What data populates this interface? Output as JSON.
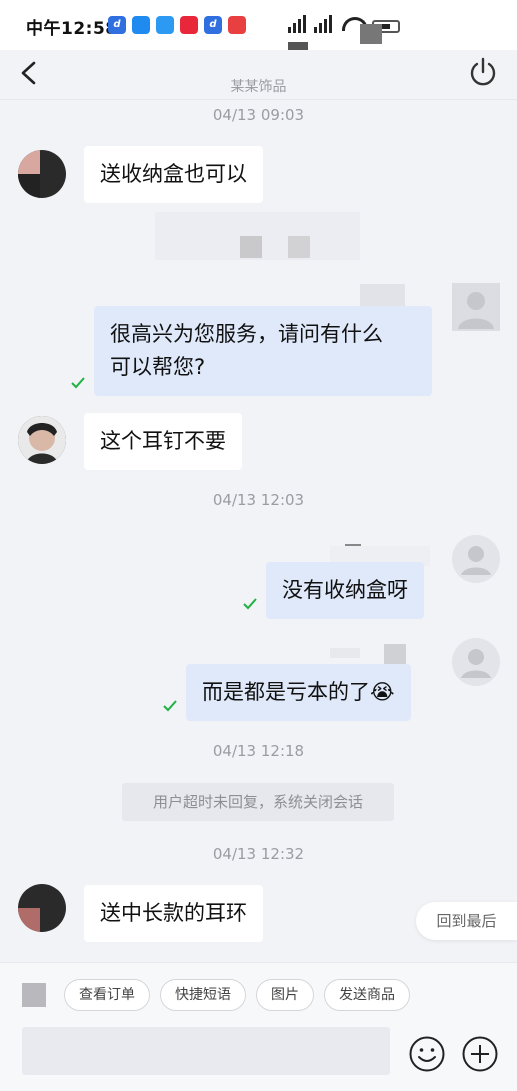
{
  "status_bar": {
    "time": "中午12:58",
    "apps": [
      {
        "icon": "d-app-icon",
        "text": "d",
        "color": "#2f6fe0"
      },
      {
        "icon": "blue-app-icon",
        "text": "",
        "color": "#1f8bf0"
      },
      {
        "icon": "blue-app-icon-2",
        "text": "",
        "color": "#2c9af2"
      },
      {
        "icon": "red-app-icon",
        "text": "",
        "color": "#e8273a"
      },
      {
        "icon": "d-app-icon-2",
        "text": "d",
        "color": "#2f6fe0"
      },
      {
        "icon": "red-app-icon-2",
        "text": "",
        "color": "#e84040"
      }
    ]
  },
  "nav": {
    "title": "某某饰品"
  },
  "messages": [
    {
      "type": "timestamp",
      "text": "04/13 09:03"
    },
    {
      "type": "in",
      "text": "送收纳盒也可以"
    },
    {
      "type": "out",
      "text_line1": "很高兴为您服务，请问有什么",
      "text_line2": "可以帮您?"
    },
    {
      "type": "in",
      "text": "这个耳钉不要"
    },
    {
      "type": "timestamp",
      "text": "04/13 12:03"
    },
    {
      "type": "out",
      "text": "没有收纳盒呀"
    },
    {
      "type": "out",
      "text": "而是都是亏本的了",
      "emoji": "😭"
    },
    {
      "type": "timestamp",
      "text": "04/13 12:18"
    },
    {
      "type": "system",
      "text": "用户超时未回复，系统关闭会话"
    },
    {
      "type": "timestamp",
      "text": "04/13 12:32"
    },
    {
      "type": "in",
      "text": "送中长款的耳环"
    }
  ],
  "back_latest": "回到最后",
  "quick_replies": [
    "查看订单",
    "快捷短语",
    "图片",
    "发送商品"
  ],
  "colors": {
    "accent_check": "#1fb141",
    "outgoing_bubble": "#dfe9fa",
    "incoming_bubble": "#ffffff",
    "background": "#f2f3f7"
  }
}
